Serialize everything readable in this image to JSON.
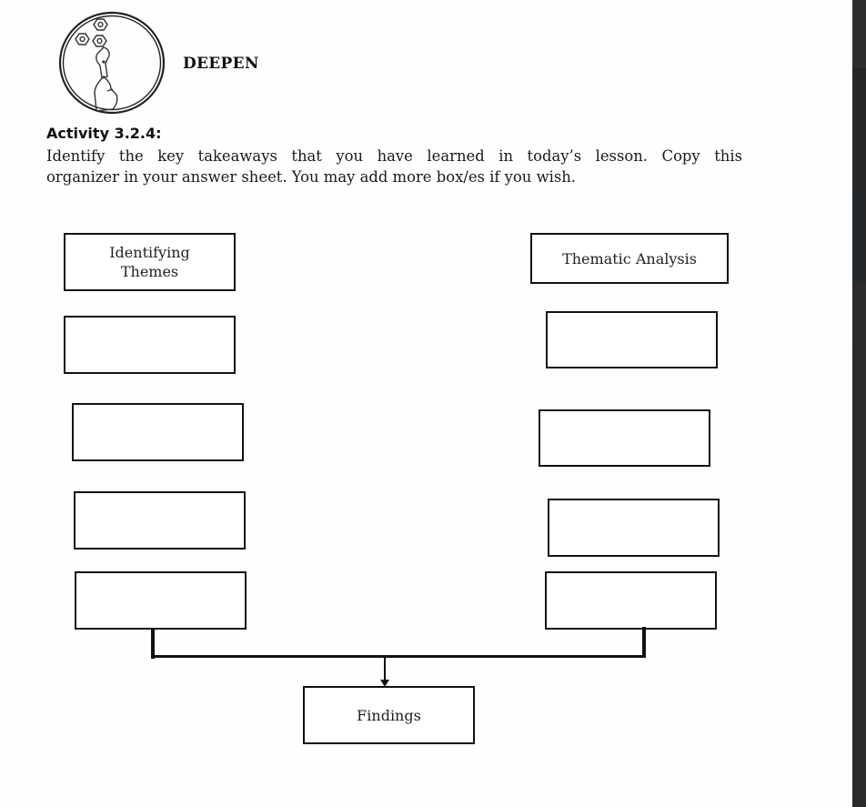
{
  "header": {
    "icon": "hand-wrench-bolts-icon",
    "section_title": "DEEPEN"
  },
  "activity": {
    "title": "Activity 3.2.4:",
    "instruction_line1": "Identify the key takeaways that you have learned in today’s lesson. Copy this",
    "instruction_line2": "organizer in your answer sheet. You may add more box/es if you wish."
  },
  "organizer": {
    "left_column": {
      "header": "Identifying Themes",
      "header_line1": "Identifying",
      "header_line2": "Themes",
      "boxes": [
        "",
        "",
        "",
        ""
      ]
    },
    "right_column": {
      "header": "Thematic Analysis",
      "boxes": [
        "",
        "",
        "",
        ""
      ]
    },
    "result_box": "Findings"
  },
  "colors": {
    "page_background": "#fefefe",
    "ink": "#111111",
    "side_strip": "#2b2b2b"
  }
}
